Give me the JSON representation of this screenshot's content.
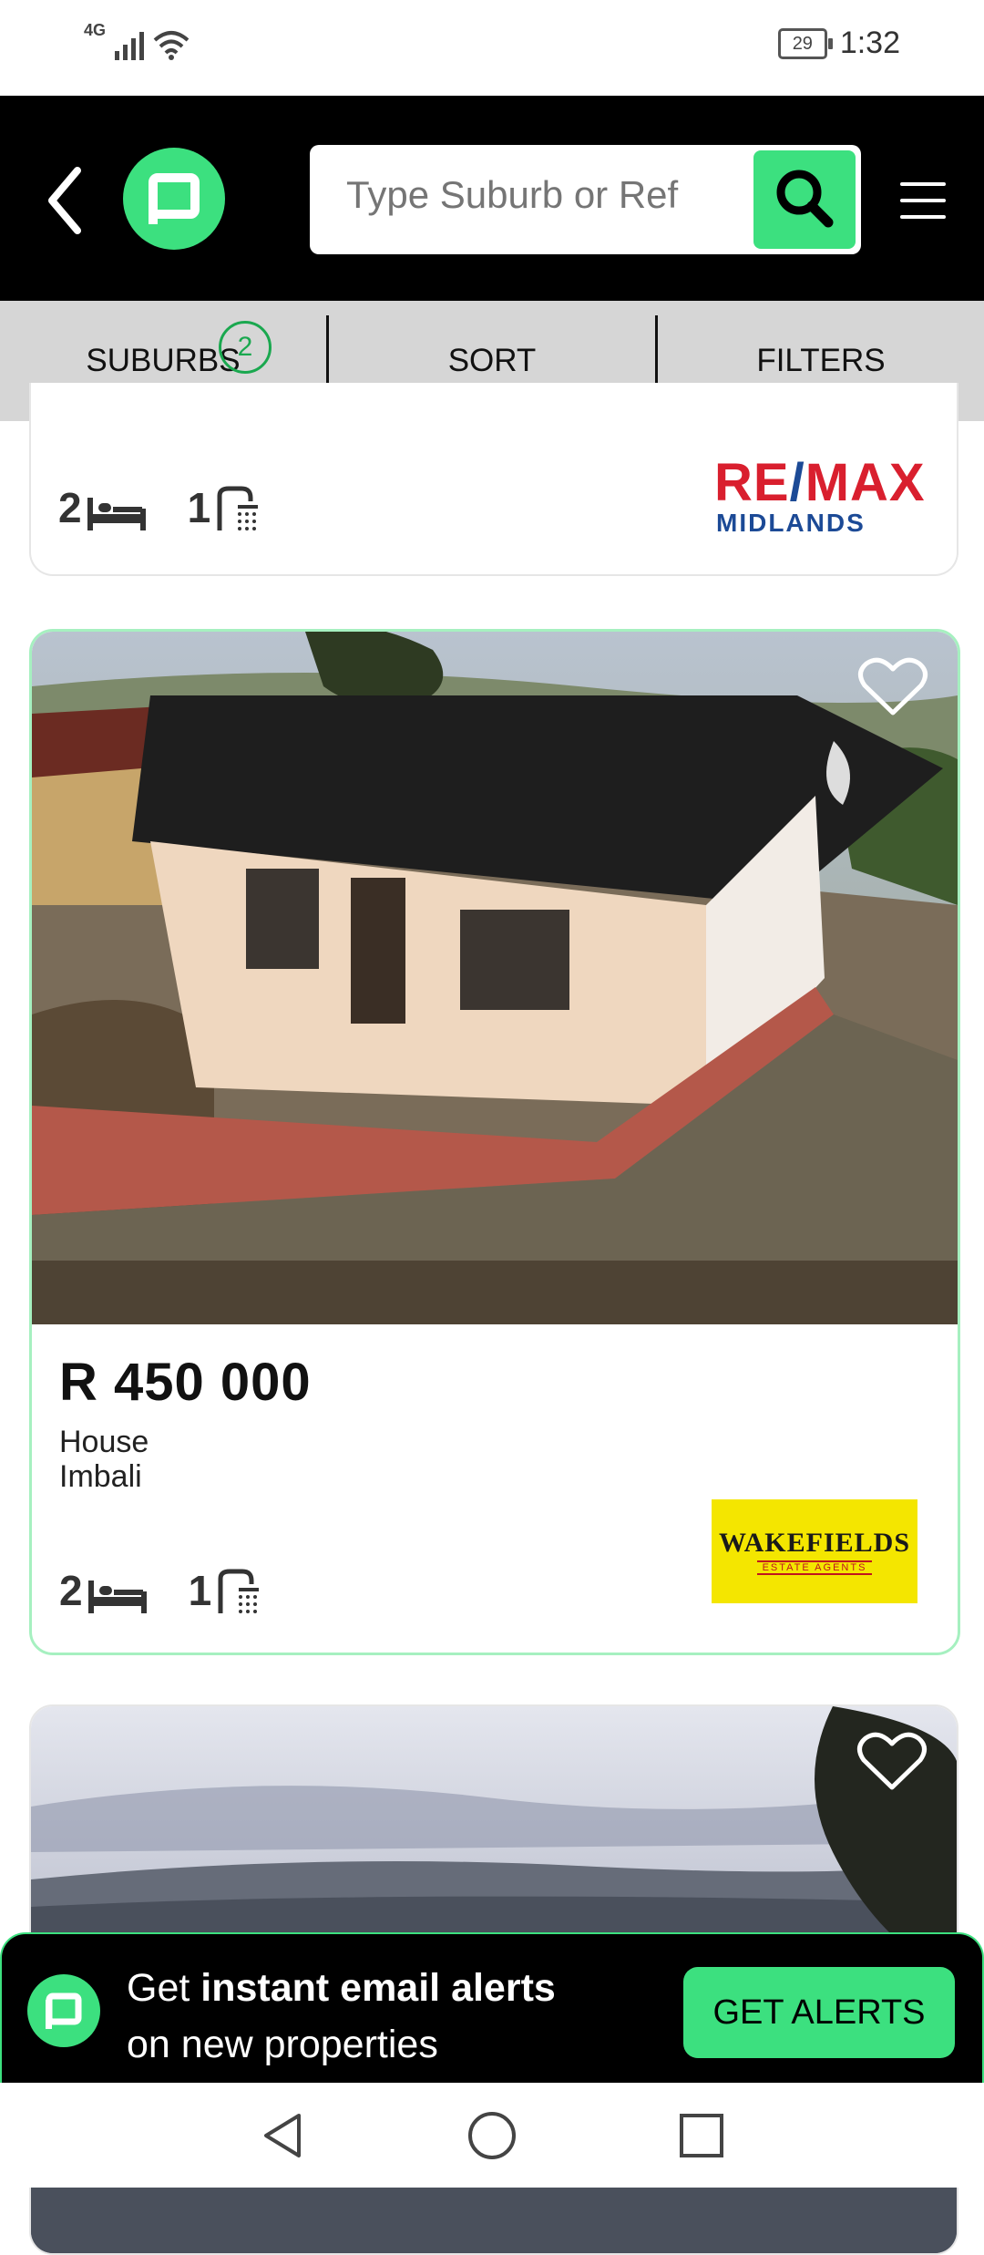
{
  "status_bar": {
    "network": "4G",
    "battery": "29",
    "time": "1:32"
  },
  "header": {
    "search_placeholder": "Type Suburb or Ref"
  },
  "filter_bar": {
    "suburbs_label": "SUBURBS",
    "suburbs_count": "2",
    "sort_label": "SORT",
    "filters_label": "FILTERS"
  },
  "listings": [
    {
      "beds": "2",
      "baths": "1",
      "agency_line1_a": "RE",
      "agency_line1_b": "/",
      "agency_line1_c": "MAX",
      "agency_line2": "MIDLANDS"
    },
    {
      "price": "R 450 000",
      "type": "House",
      "suburb": "Imbali",
      "beds": "2",
      "baths": "1",
      "agency_name": "WAKEFIELDS",
      "agency_sub": "ESTATE AGENTS"
    }
  ],
  "alert_banner": {
    "text_prefix": "Get ",
    "text_bold": "instant email alerts",
    "text_line2": "on new properties",
    "button_label": "GET ALERTS"
  },
  "colors": {
    "brand_green": "#3ce07f",
    "header_bg": "#000000",
    "filter_bg": "#d6d6d6",
    "badge_green": "#1aa84f"
  },
  "icons": [
    "back-arrow-icon",
    "app-logo-icon",
    "search-icon",
    "hamburger-menu-icon",
    "bed-icon",
    "shower-icon",
    "heart-icon",
    "nav-back-icon",
    "nav-home-icon",
    "nav-recents-icon"
  ]
}
